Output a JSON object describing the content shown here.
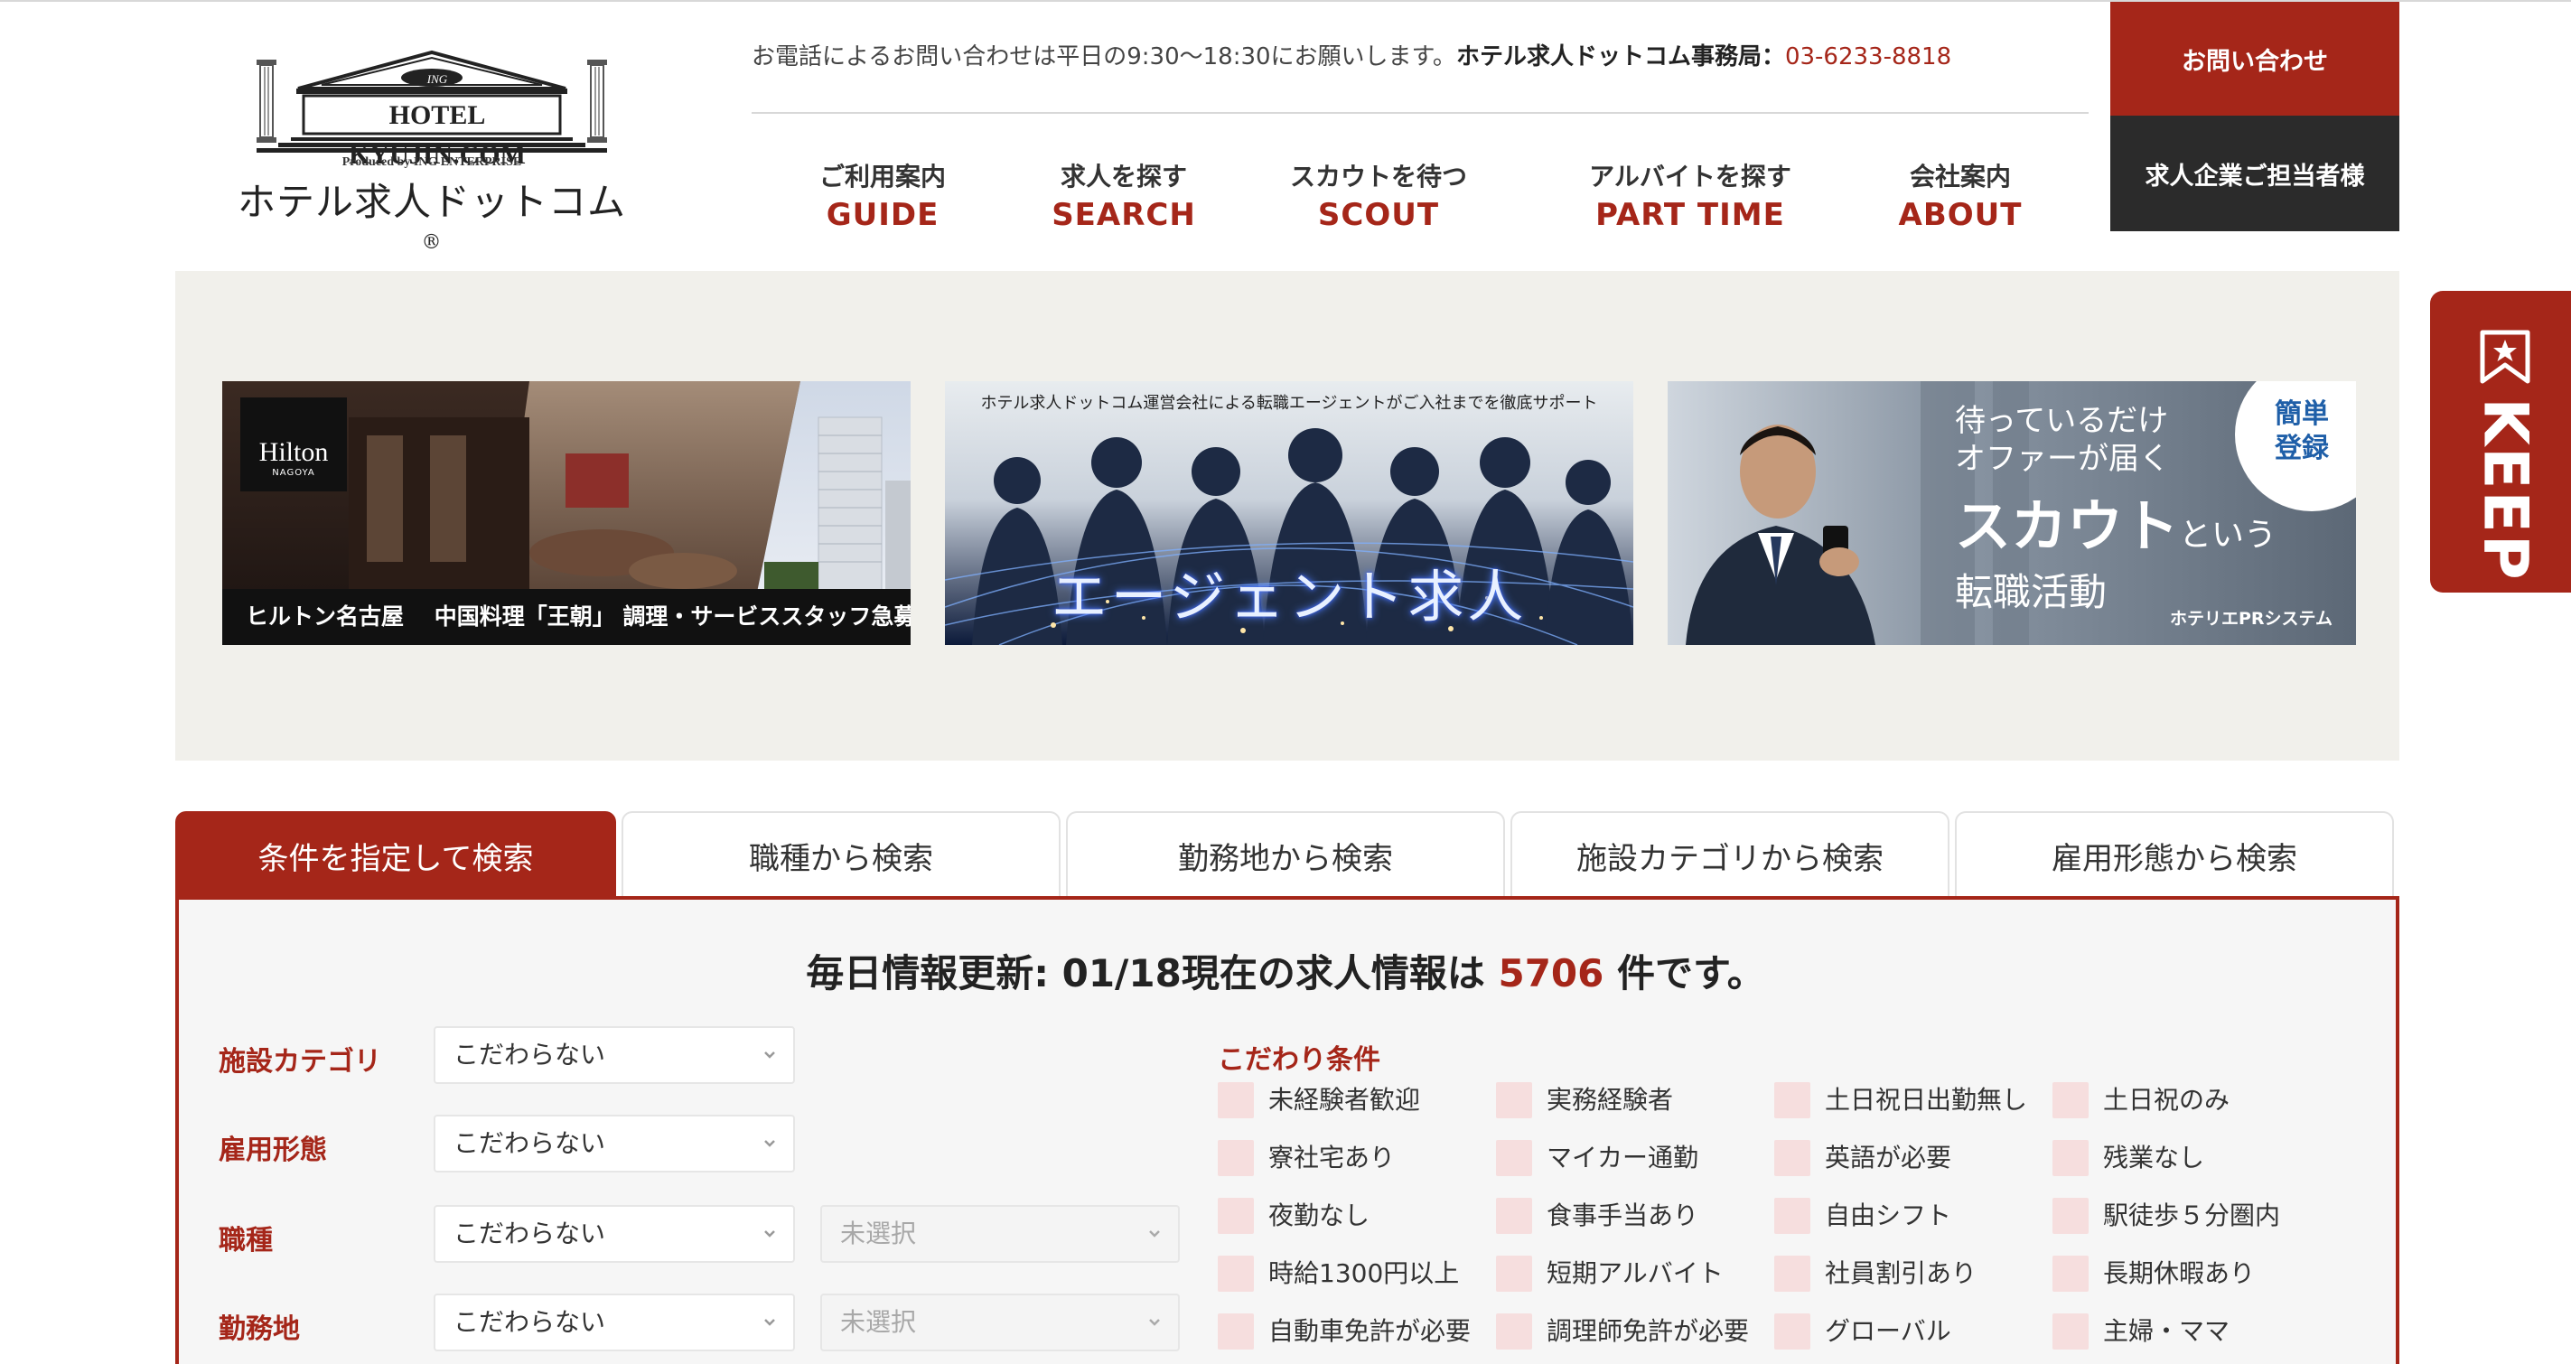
{
  "header": {
    "logo": {
      "en": "HOTEL KYUJIN.COM",
      "mono": "ING",
      "produced": "Produced by ING ENTERPRISE",
      "jp": "ホテル求人ドットコム",
      "reg": "®"
    },
    "contact": {
      "note": "お電話によるお問い合わせは平日の9:30〜18:30にお願いします。",
      "office": "ホテル求人ドットコム事務局：",
      "phone": "03-6233-8818"
    },
    "nav": [
      {
        "jp": "ご利用案内",
        "en": "GUIDE"
      },
      {
        "jp": "求人を探す",
        "en": "SEARCH"
      },
      {
        "jp": "スカウトを待つ",
        "en": "SCOUT"
      },
      {
        "jp": "アルバイトを探す",
        "en": "PART TIME"
      },
      {
        "jp": "会社案内",
        "en": "ABOUT"
      }
    ],
    "inquiry_label": "お問い合わせ",
    "company_label": "求人企業ご担当者様"
  },
  "keep": {
    "label": "KEEP",
    "icon": "star-bookmark-icon"
  },
  "banners": [
    {
      "logo": "Hilton",
      "logo_sub": "NAGOYA",
      "caption": "ヒルトン名古屋　 中国料理「王朝」 調理・サービススタッフ急募"
    },
    {
      "top": "ホテル求人ドットコム運営会社による転職エージェントがご入社までを徹底サポート",
      "title": "エージェント求人"
    },
    {
      "line1": "待っているだけ",
      "line2": "オファーが届く",
      "line3_main": "スカウト",
      "line3_small": "という",
      "line4": "転職活動",
      "badge": "簡単 登録",
      "brand": "ホテリエPRシステム"
    }
  ],
  "search": {
    "tabs": [
      "条件を指定して検索",
      "職種から検索",
      "勤務地から検索",
      "施設カテゴリから検索",
      "雇用形態から検索"
    ],
    "active_tab": 0,
    "count": {
      "prefix": "毎日情報更新: 01/18現在の求人情報は ",
      "number": "5706",
      "suffix": " 件です。"
    },
    "rows": [
      {
        "label": "施設カテゴリ",
        "value": "こだわらない"
      },
      {
        "label": "雇用形態",
        "value": "こだわらない"
      },
      {
        "label": "職種",
        "value": "こだわらない",
        "sub": "未選択"
      },
      {
        "label": "勤務地",
        "value": "こだわらない",
        "sub": "未選択"
      }
    ],
    "kodawari_title": "こだわり条件",
    "conditions": [
      "未経験者歓迎",
      "実務経験者",
      "土日祝日出勤無し",
      "土日祝のみ",
      "寮社宅あり",
      "マイカー通勤",
      "英語が必要",
      "残業なし",
      "夜勤なし",
      "食事手当あり",
      "自由シフト",
      "駅徒歩５分圏内",
      "時給1300円以上",
      "短期アルバイト",
      "社員割引あり",
      "長期休暇あり",
      "自動車免許が必要",
      "調理師免許が必要",
      "グローバル",
      "主婦・ママ"
    ]
  },
  "colors": {
    "accent": "#a52619",
    "dark": "#2b2b2b",
    "banner_bg": "#f1f0eb",
    "checkbox": "#f6dede"
  }
}
